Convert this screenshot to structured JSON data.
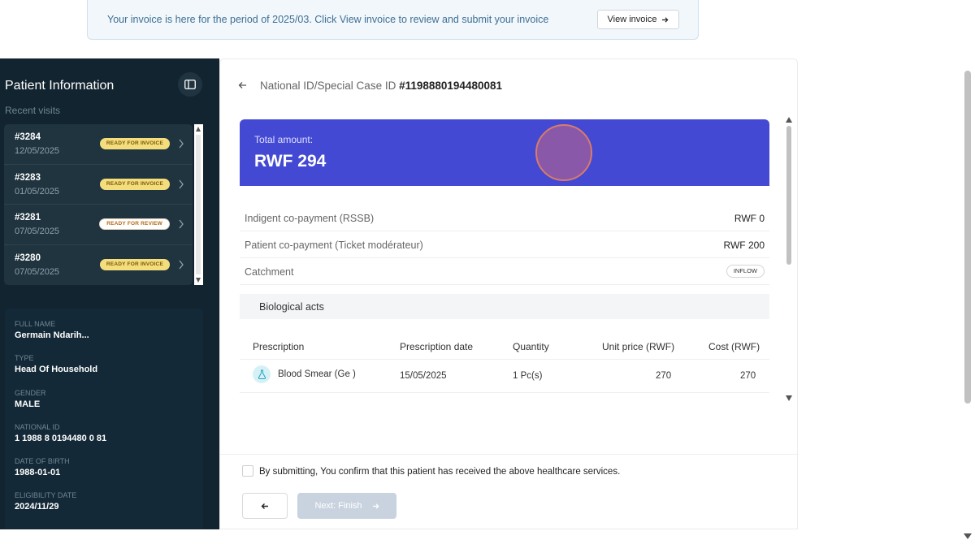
{
  "banner": {
    "text": "Your invoice is here for the period of 2025/03. Click View invoice to review and submit your invoice",
    "button_label": "View invoice"
  },
  "sidebar": {
    "title": "Patient Information",
    "recent_label": "Recent visits",
    "visits": [
      {
        "id": "#3284",
        "date": "12/05/2025",
        "status": "READY FOR INVOICE"
      },
      {
        "id": "#3283",
        "date": "01/05/2025",
        "status": "READY FOR INVOICE"
      },
      {
        "id": "#3281",
        "date": "07/05/2025",
        "status": "READY FOR REVIEW"
      },
      {
        "id": "#3280",
        "date": "07/05/2025",
        "status": "READY FOR INVOICE"
      }
    ],
    "info": [
      {
        "label": "FULL NAME",
        "value": "Germain Ndarih..."
      },
      {
        "label": "TYPE",
        "value": "Head Of Household"
      },
      {
        "label": "GENDER",
        "value": "MALE"
      },
      {
        "label": "NATIONAL ID",
        "value": "1 1988 8 0194480 0 81"
      },
      {
        "label": "DATE OF BIRTH",
        "value": "1988-01-01"
      },
      {
        "label": "ELIGIBILITY DATE",
        "value": "2024/11/29"
      }
    ]
  },
  "main": {
    "id_label": "National ID/Special Case ID",
    "id_value": "#1198880194480081",
    "total_label": "Total amount:",
    "total_value": "RWF 294",
    "rows": [
      {
        "label": "Indigent co-payment (RSSB)",
        "value": "RWF 0"
      },
      {
        "label": "Patient co-payment (Ticket modérateur)",
        "value": "RWF 200"
      },
      {
        "label": "Catchment",
        "value": "INFLOW"
      }
    ],
    "section_title": "Biological acts",
    "table": {
      "headers": [
        "Prescription",
        "Prescription date",
        "Quantity",
        "Unit price (RWF)",
        "Cost (RWF)"
      ],
      "rows": [
        {
          "prescription": "Blood Smear (Ge )",
          "date": "15/05/2025",
          "quantity": "1 Pc(s)",
          "unit_price": "270",
          "cost": "270"
        }
      ]
    },
    "confirm_text": "By submitting, You confirm that this patient has received the above healthcare services.",
    "next_label": "Next: Finish"
  },
  "colors": {
    "sidebar_bg": "#12242f",
    "total_bg": "#4349d2",
    "badge_invoice": "#f4dd7d",
    "banner_bg": "#f1f7fb"
  }
}
